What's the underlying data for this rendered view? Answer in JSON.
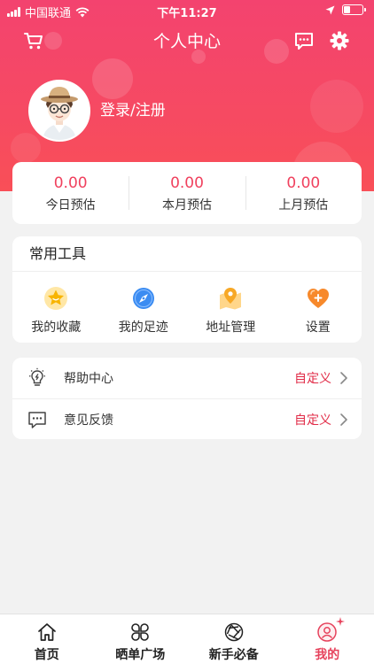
{
  "status_bar": {
    "carrier": "中国联通",
    "time": "下午11:27"
  },
  "nav": {
    "title": "个人中心",
    "icons": [
      "cart-icon",
      "message-icon",
      "gear-icon"
    ]
  },
  "profile": {
    "login_label": "登录/注册",
    "avatar": "cartoon-avatar"
  },
  "stats": [
    {
      "value": "0.00",
      "label": "今日预估"
    },
    {
      "value": "0.00",
      "label": "本月预估"
    },
    {
      "value": "0.00",
      "label": "上月预估"
    }
  ],
  "tools": {
    "title": "常用工具",
    "items": [
      {
        "label": "我的收藏",
        "icon": "star-icon"
      },
      {
        "label": "我的足迹",
        "icon": "compass-icon"
      },
      {
        "label": "地址管理",
        "icon": "map-pin-icon"
      },
      {
        "label": "设置",
        "icon": "heart-plus-icon"
      }
    ]
  },
  "menu": [
    {
      "label": "帮助中心",
      "tag": "自定义",
      "icon": "lightbulb-icon"
    },
    {
      "label": "意见反馈",
      "tag": "自定义",
      "icon": "feedback-icon"
    }
  ],
  "tabbar": [
    {
      "label": "首页",
      "icon": "home-icon",
      "active": false
    },
    {
      "label": "晒单广场",
      "icon": "clover-icon",
      "active": false
    },
    {
      "label": "新手必备",
      "icon": "aperture-icon",
      "active": false
    },
    {
      "label": "我的",
      "icon": "user-icon",
      "active": true
    }
  ],
  "colors": {
    "header_start": "#f3436f",
    "header_end": "#f94f57",
    "accent": "#f0415e",
    "tag": "#e12b47",
    "background": "#f2f2f2"
  }
}
